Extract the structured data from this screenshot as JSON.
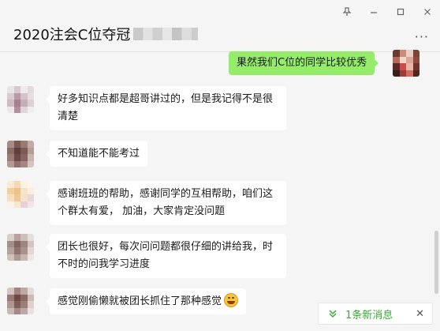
{
  "window": {
    "pin_icon": "pin-icon",
    "minimize_icon": "minimize-icon",
    "maximize_icon": "maximize-icon",
    "close_icon": "close-icon"
  },
  "header": {
    "title": "2020注会C位夺冠",
    "more_label": "···"
  },
  "messages": [
    {
      "side": "right",
      "text": "果然我们C位的同学比较优秀"
    },
    {
      "side": "left",
      "text": "好多知识点都是超哥讲过的，但是我记得不是很清楚"
    },
    {
      "side": "left",
      "text": "不知道能不能考过"
    },
    {
      "side": "left",
      "text": "感谢班班的帮助，感谢同学的互相帮助，咱们这个群太有爱， 加油，大家肯定没问题"
    },
    {
      "side": "left",
      "text": "团长也很好，每次问问题都很仔细的讲给我，时不时的问我学习进度"
    },
    {
      "side": "left",
      "text": "感觉刚偷懒就被团长抓住了那种感觉",
      "emoji": "grinning-emoji"
    }
  ],
  "new_message_bar": {
    "label": "1条新消息",
    "close": "✕"
  },
  "colors": {
    "background": "#f5f5f5",
    "self_bubble": "#95ec69",
    "other_bubble": "#ffffff",
    "accent_green": "#3aaa35"
  }
}
